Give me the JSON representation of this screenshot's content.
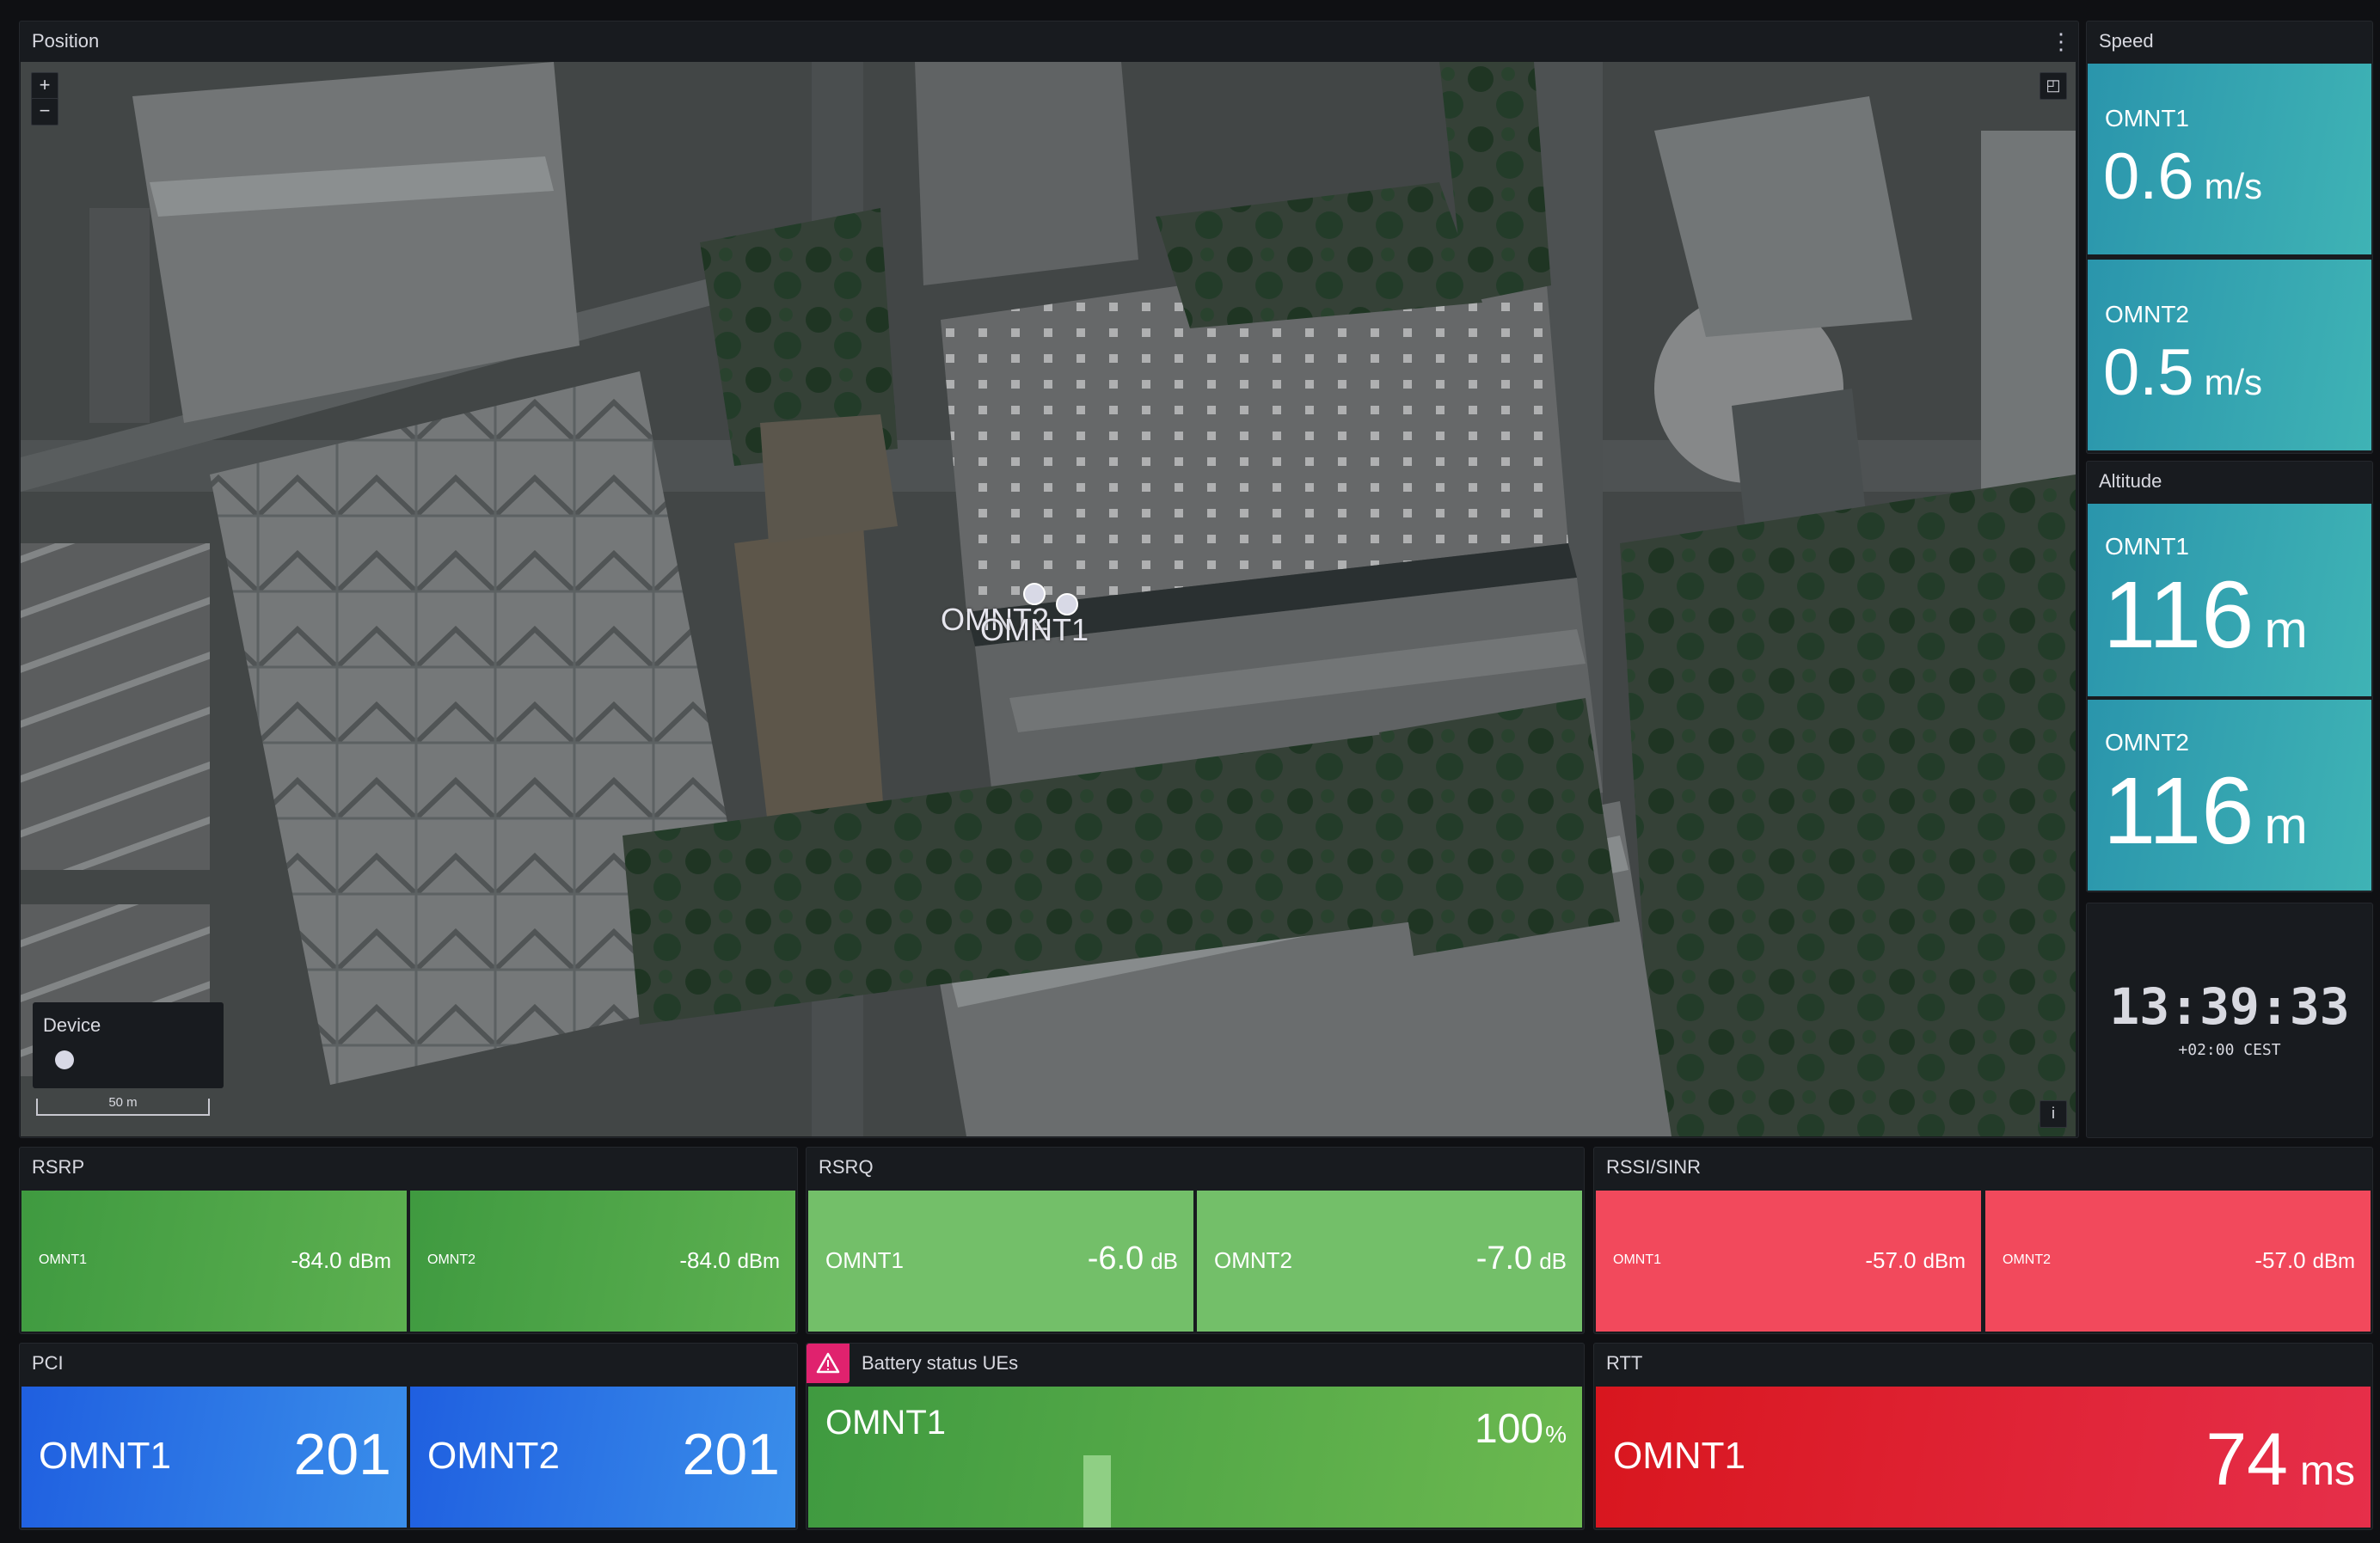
{
  "position": {
    "title": "Position",
    "markers": [
      {
        "label": "OMNT2"
      },
      {
        "label": "OMNT1"
      }
    ],
    "legend": {
      "title": "Device"
    },
    "scale": "50 m",
    "zoom_in": "+",
    "zoom_out": "−",
    "info": "i"
  },
  "speed": {
    "title": "Speed",
    "items": [
      {
        "name": "OMNT1",
        "value": "0.6",
        "unit": "m/s"
      },
      {
        "name": "OMNT2",
        "value": "0.5",
        "unit": "m/s"
      }
    ]
  },
  "altitude": {
    "title": "Altitude",
    "items": [
      {
        "name": "OMNT1",
        "value": "116",
        "unit": "m"
      },
      {
        "name": "OMNT2",
        "value": "116",
        "unit": "m"
      }
    ]
  },
  "clock": {
    "time": "13:39:33",
    "zone": "+02:00 CEST"
  },
  "rsrp": {
    "title": "RSRP",
    "items": [
      {
        "name": "OMNT1",
        "value": "-84.0",
        "unit": "dBm"
      },
      {
        "name": "OMNT2",
        "value": "-84.0",
        "unit": "dBm"
      }
    ]
  },
  "rsrq": {
    "title": "RSRQ",
    "items": [
      {
        "name": "OMNT1",
        "value": "-6.0",
        "unit": "dB"
      },
      {
        "name": "OMNT2",
        "value": "-7.0",
        "unit": "dB"
      }
    ]
  },
  "rssi": {
    "title": "RSSI/SINR",
    "items": [
      {
        "name": "OMNT1",
        "value": "-57.0",
        "unit": "dBm"
      },
      {
        "name": "OMNT2",
        "value": "-57.0",
        "unit": "dBm"
      }
    ]
  },
  "pci": {
    "title": "PCI",
    "items": [
      {
        "name": "OMNT1",
        "value": "201"
      },
      {
        "name": "OMNT2",
        "value": "201"
      }
    ]
  },
  "battery": {
    "title": "Battery status UEs",
    "name": "OMNT1",
    "value": "100",
    "unit": "%",
    "level": 1.0
  },
  "rtt": {
    "title": "RTT",
    "name": "OMNT1",
    "value": "74",
    "unit": "ms"
  },
  "colors": {
    "speed_tile": "#2ea4b4",
    "green_dark": "#45a049",
    "green_light": "#73bf69",
    "red_light": "#f2495c",
    "blue": "#1f60c4",
    "red_dark": "#e02f44"
  }
}
